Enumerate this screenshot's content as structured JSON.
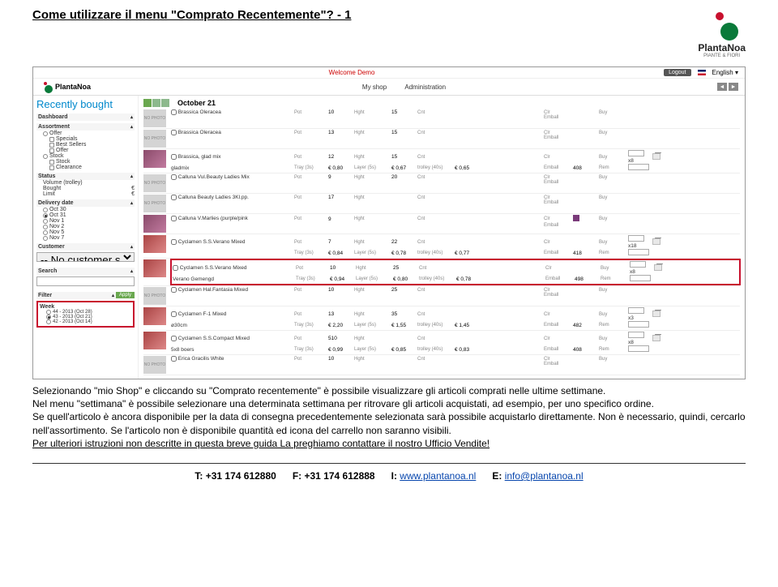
{
  "doc": {
    "title": "Come utilizzare il menu \"Comprato Recentemente\"? - 1",
    "brand": "PlantaNoa",
    "brand_sub": "PIANTE & FIORI"
  },
  "app": {
    "welcome": "Welcome Demo",
    "logout": "Logout",
    "lang": "English ▾",
    "brand": "PlantaNoa",
    "nav1": "My shop",
    "nav2": "Administration",
    "page_title": "Recently bought",
    "date_header": "October 21",
    "sidebar": {
      "dashboard": "Dashboard",
      "assortment": "Assortment",
      "offer": "Offer",
      "specials": "Specials",
      "bestsellers": "Best Sellers",
      "offer2": "Offer",
      "stock": "Stock",
      "stock2": "Stock",
      "clearance": "Clearance",
      "status": "Status",
      "volume": "Volume (trolley)",
      "bought": "Bought",
      "limit": "Limit",
      "euro": "€",
      "delivery": "Delivery date",
      "d1": "Oct 30",
      "d2": "Oct 31",
      "d3": "Nov 1",
      "d4": "Nov 2",
      "d5": "Nov 5",
      "d6": "Nov 7",
      "customer": "Customer",
      "nocust": "-- No customer selected --",
      "search": "Search",
      "filter": "Filter",
      "apply": "Apply",
      "week": "Week",
      "w1": "44 - 2013 (Oct 28)",
      "w2": "43 - 2013 (Oct 21)",
      "w3": "42 - 2013 (Oct 14)"
    },
    "labels": {
      "pot": "Pot",
      "tray": "Tray (3s)",
      "hght": "Hght",
      "layer": "Layer (5s)",
      "cnt": "Cnt",
      "trolley": "trolley (40s)",
      "clr": "Clr",
      "emball": "Emball",
      "buy": "Buy",
      "rem": "Rem"
    },
    "rows": [
      {
        "name": "Brassica Oleracea",
        "sub": "",
        "pot": "10",
        "hght": "15",
        "cnt": "",
        "clr": "",
        "emball": "",
        "photo": "NO PHOTO"
      },
      {
        "name": "Brassica Oleracea",
        "sub": "",
        "pot": "13",
        "hght": "15",
        "cnt": "",
        "clr": "",
        "emball": "",
        "photo": "NO PHOTO"
      },
      {
        "name": "Brassica, glad mix",
        "sub": "gladmix",
        "pot": "12",
        "tray": "€ 0,80",
        "hght": "15",
        "layer": "€ 0,67",
        "trolley": "€ 0,65",
        "emball": "408",
        "buy": "x8",
        "img": "img"
      },
      {
        "name": "Calluna Vul.Beauty Ladies Mix",
        "sub": "",
        "pot": "9",
        "hght": "20",
        "cnt": "",
        "clr": "",
        "emball": "",
        "photo": "NO PHOTO"
      },
      {
        "name": "Calluna Beauty Ladies 3Kl.pp.",
        "sub": "",
        "pot": "17",
        "hght": "",
        "photo": "NO PHOTO"
      },
      {
        "name": "Calluna V.Marlies (purple/pink",
        "sub": "",
        "pot": "9",
        "hght": "",
        "clr": "sq",
        "img": "img"
      },
      {
        "name": "Cyclamen S.S.Verano Mixed",
        "sub": "",
        "pot": "7",
        "tray": "€ 0,84",
        "hght": "22",
        "layer": "€ 0,78",
        "trolley": "€ 0,77",
        "emball": "418",
        "buy": "x18",
        "img": "img3"
      },
      {
        "name": "Cyclamen S.S.Verano Mixed",
        "sub": "Verano Gemengd",
        "pot": "10",
        "tray": "€ 0,94",
        "hght": "25",
        "layer": "€ 0,80",
        "trolley": "€ 0,78",
        "emball": "498",
        "buy": "x8",
        "img": "img3",
        "hl": true
      },
      {
        "name": "Cyclamen Hal.Fantasia Mixed",
        "sub": "",
        "pot": "10",
        "hght": "25",
        "photo": "NO PHOTO"
      },
      {
        "name": "Cyclamen F-1 Mixed",
        "sub": "ø30cm",
        "pot": "13",
        "tray": "€ 2,20",
        "hght": "35",
        "layer": "€ 1,55",
        "trolley": "€ 1,45",
        "emball": "482",
        "buy": "x3",
        "img": "img3"
      },
      {
        "name": "Cyclamen S.S.Compact Mixed",
        "sub": "5x8 boers",
        "pot": "510",
        "tray": "€ 0,99",
        "hght": "",
        "layer": "€ 0,85",
        "trolley": "€ 0,83",
        "emball": "408",
        "buy": "x8",
        "img": "img3"
      },
      {
        "name": "Erica Gracilis White",
        "sub": "",
        "pot": "10",
        "hght": "",
        "photo": "NO PHOTO"
      }
    ]
  },
  "explain": {
    "p1": "Selezionando \"mio Shop\" e cliccando su \"Comprato recentemente\" è possibile visualizzare gli articoli comprati nelle ultime settimane.",
    "p2": "Nel menu \"settimana\" è possibile selezionare una determinata settimana per ritrovare gli articoli acquistati, ad esempio, per uno specifico ordine.",
    "p3": "Se quell'articolo è ancora disponibile per la data di consegna precedentemente selezionata sarà possibile acquistarlo direttamente. Non è necessario, quindi, cercarlo nell'assortimento. Se l'articolo non è disponibile quantità ed icona del carrello non saranno visibili.",
    "p4": "Per ulteriori istruzioni non descritte in questa breve guida La preghiamo contattare il nostro Ufficio Vendite!"
  },
  "footer": {
    "t_lbl": "T: ",
    "t": "+31 174 612880",
    "f_lbl": "F: ",
    "f": "+31 174 612888",
    "i_lbl": "I: ",
    "i": "www.plantanoa.nl",
    "e_lbl": "E: ",
    "e": "info@plantanoa.nl"
  }
}
